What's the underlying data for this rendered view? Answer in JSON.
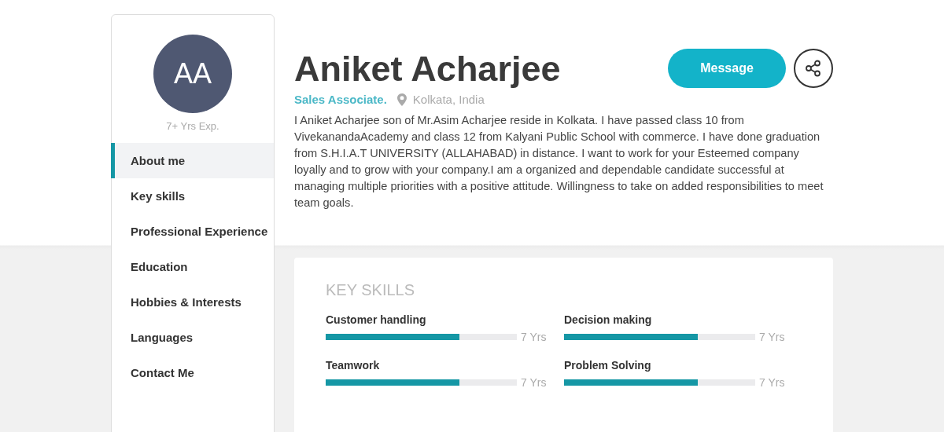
{
  "profile": {
    "initials": "AA",
    "experience": "7+ Yrs Exp.",
    "name": "Aniket Acharjee",
    "role": "Sales Associate.",
    "location": "Kolkata, India",
    "about": "I Aniket Acharjee son of Mr.Asim Acharjee reside in Kolkata. I have passed class 10 from VivekanandaAcademy and class 12 from Kalyani Public School with commerce. I have done graduation from S.H.I.A.T UNIVERSITY (ALLAHABAD) in distance. I want to work for your Esteemed company loyally and to grow with your company.I am a organized and dependable candidate successful at managing multiple priorities with a positive attitude. Willingness to take on added responsibilities to meet team goals."
  },
  "actions": {
    "message_button": "Message"
  },
  "sidebar": {
    "items": [
      {
        "label": "About me",
        "selected": true
      },
      {
        "label": "Key skills",
        "selected": false
      },
      {
        "label": "Professional Experience",
        "selected": false
      },
      {
        "label": "Education",
        "selected": false
      },
      {
        "label": "Hobbies & Interests",
        "selected": false
      },
      {
        "label": "Languages",
        "selected": false
      },
      {
        "label": "Contact Me",
        "selected": false
      }
    ]
  },
  "key_skills": {
    "title": "KEY SKILLS",
    "skills": [
      {
        "name": "Customer handling",
        "level": 0.7,
        "reading": "7 Yrs"
      },
      {
        "name": "Decision making",
        "level": 0.7,
        "reading": "7 Yrs"
      },
      {
        "name": "Teamwork",
        "level": 0.7,
        "reading": "7 Yrs"
      },
      {
        "name": "Problem Solving",
        "level": 0.7,
        "reading": "7 Yrs"
      }
    ]
  }
}
